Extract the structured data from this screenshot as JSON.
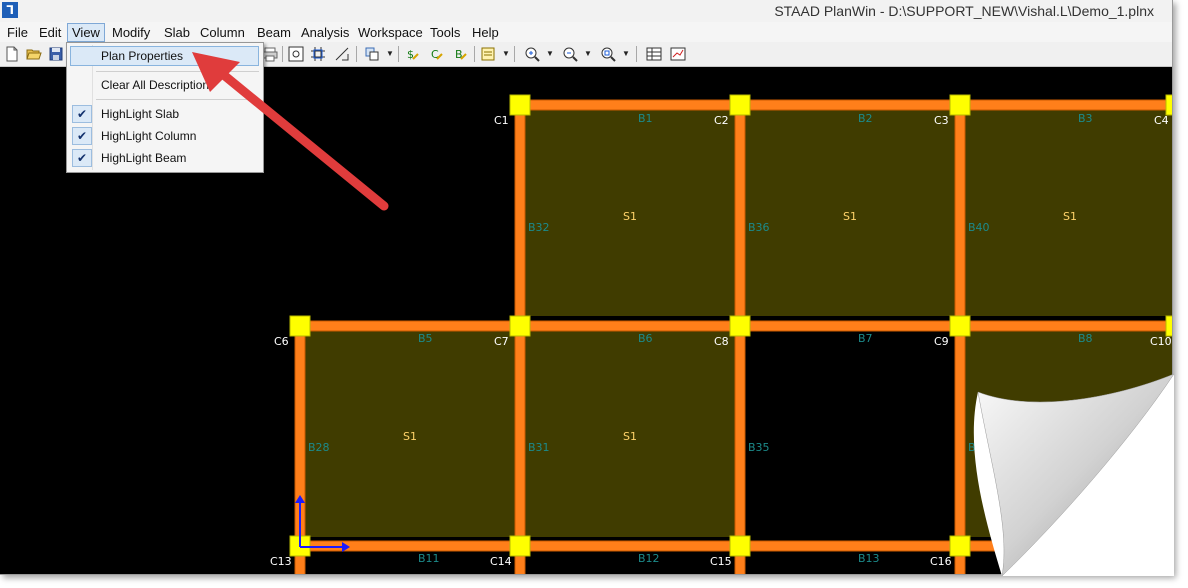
{
  "window": {
    "title": "STAAD PlanWin - D:\\SUPPORT_NEW\\Vishal.L\\Demo_1.plnx",
    "app_icon_glyph": "⅂"
  },
  "menubar": [
    {
      "id": "file",
      "label": "File"
    },
    {
      "id": "edit",
      "label": "Edit"
    },
    {
      "id": "view",
      "label": "View",
      "open": true
    },
    {
      "id": "modify",
      "label": "Modify"
    },
    {
      "id": "slab",
      "label": "Slab"
    },
    {
      "id": "column",
      "label": "Column"
    },
    {
      "id": "beam",
      "label": "Beam"
    },
    {
      "id": "analysis",
      "label": "Analysis"
    },
    {
      "id": "workspace",
      "label": "Workspace"
    },
    {
      "id": "tools",
      "label": "Tools"
    },
    {
      "id": "help",
      "label": "Help"
    }
  ],
  "toolbar": {
    "new_icon": "new-file-icon",
    "open_icon": "open-folder-icon",
    "save_icon": "save-icon"
  },
  "view_menu": {
    "items": [
      {
        "label": "Plan Properties",
        "highlighted": true,
        "checked": false
      },
      {
        "label": "Clear All Description",
        "checked": false
      },
      {
        "label": "HighLight Slab",
        "checked": true
      },
      {
        "label": "HighLight Column",
        "checked": true
      },
      {
        "label": "HighLight Beam",
        "checked": true
      }
    ],
    "check_glyph": "✔"
  },
  "colors": {
    "canvas_bg": "#000000",
    "beam": "#ff7f1a",
    "beam_outline": "#c85a00",
    "column": "#ffff00",
    "slab_fill": "#403c00",
    "slab_label": "#ffd36a",
    "beam_label": "#1c8a8a",
    "column_label": "#ffffff",
    "axis": "#1a1aff",
    "arrow": "#e03c3c"
  },
  "plan": {
    "columns": [
      "C1",
      "C2",
      "C3",
      "C4",
      "C6",
      "C7",
      "C8",
      "C9",
      "C10",
      "C13",
      "C14",
      "C15",
      "C16"
    ],
    "beams_horizontal": [
      "B1",
      "B2",
      "B3",
      "B5",
      "B6",
      "B7",
      "B8",
      "B11",
      "B12",
      "B13"
    ],
    "beams_vertical": [
      "B32",
      "B36",
      "B40",
      "B28",
      "B31",
      "B35",
      "B39"
    ],
    "slabs": [
      "S1",
      "S1",
      "S1",
      "S1",
      "S1"
    ]
  }
}
